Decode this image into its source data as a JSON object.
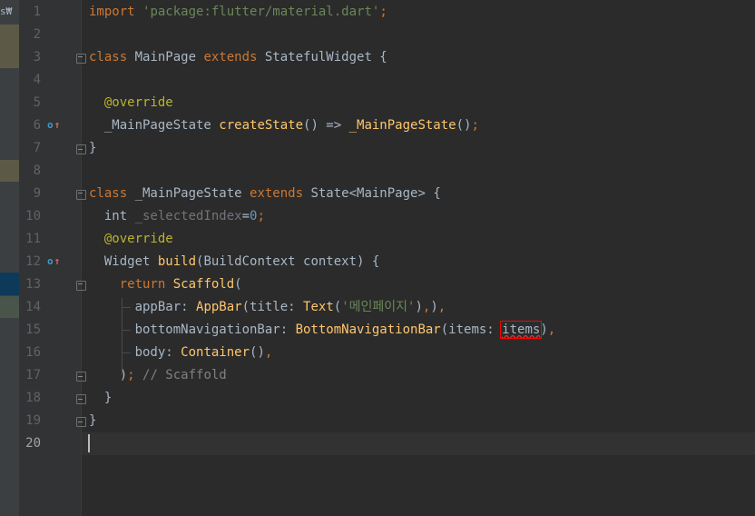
{
  "editor": {
    "left_strip_label": "s₩",
    "caret_line": 20,
    "lines": [
      {
        "num": "1",
        "tokens": [
          {
            "t": "import ",
            "c": "kw"
          },
          {
            "t": "'package:flutter/material.dart'",
            "c": "str"
          },
          {
            "t": ";",
            "c": "kw"
          }
        ]
      },
      {
        "num": "2",
        "tokens": []
      },
      {
        "num": "3",
        "tokens": [
          {
            "t": "class ",
            "c": "kw"
          },
          {
            "t": "MainPage ",
            "c": "cls"
          },
          {
            "t": "extends ",
            "c": "kw"
          },
          {
            "t": "StatefulWidget {",
            "c": "cls"
          }
        ]
      },
      {
        "num": "4",
        "tokens": []
      },
      {
        "num": "5",
        "tokens": [
          {
            "t": "  @override",
            "c": "ann"
          }
        ]
      },
      {
        "num": "6",
        "tokens": [
          {
            "t": "  _MainPageState ",
            "c": "cls"
          },
          {
            "t": "createState",
            "c": "fn"
          },
          {
            "t": "() => ",
            "c": "cls"
          },
          {
            "t": "_MainPageState",
            "c": "fn"
          },
          {
            "t": "()",
            "c": "cls"
          },
          {
            "t": ";",
            "c": "kw"
          }
        ]
      },
      {
        "num": "7",
        "tokens": [
          {
            "t": "}",
            "c": "cls"
          }
        ]
      },
      {
        "num": "8",
        "tokens": []
      },
      {
        "num": "9",
        "tokens": [
          {
            "t": "class ",
            "c": "kw"
          },
          {
            "t": "_MainPageState ",
            "c": "cls"
          },
          {
            "t": "extends ",
            "c": "kw"
          },
          {
            "t": "State<MainPage> {",
            "c": "cls"
          }
        ]
      },
      {
        "num": "10",
        "tokens": [
          {
            "t": "  int ",
            "c": "cls"
          },
          {
            "t": "_selectedIndex",
            "c": "unused"
          },
          {
            "t": "=",
            "c": "cls"
          },
          {
            "t": "0",
            "c": "num"
          },
          {
            "t": ";",
            "c": "kw"
          }
        ]
      },
      {
        "num": "11",
        "tokens": [
          {
            "t": "  @override",
            "c": "ann"
          }
        ]
      },
      {
        "num": "12",
        "tokens": [
          {
            "t": "  Widget ",
            "c": "cls"
          },
          {
            "t": "build",
            "c": "fn"
          },
          {
            "t": "(BuildContext context) {",
            "c": "cls"
          }
        ]
      },
      {
        "num": "13",
        "tokens": [
          {
            "t": "    ",
            "c": "cls"
          },
          {
            "t": "return ",
            "c": "kw"
          },
          {
            "t": "Scaffold",
            "c": "fn"
          },
          {
            "t": "(",
            "c": "cls"
          }
        ]
      },
      {
        "num": "14",
        "tokens": [
          {
            "t": "      appBar: ",
            "c": "named"
          },
          {
            "t": "AppBar",
            "c": "fn"
          },
          {
            "t": "(title: ",
            "c": "cls"
          },
          {
            "t": "Text",
            "c": "fn"
          },
          {
            "t": "(",
            "c": "cls"
          },
          {
            "t": "'메인페이지'",
            "c": "str"
          },
          {
            "t": ")",
            "c": "cls"
          },
          {
            "t": ",",
            "c": "kw"
          },
          {
            "t": ")",
            "c": "cls"
          },
          {
            "t": ",",
            "c": "kw"
          }
        ]
      },
      {
        "num": "15",
        "tokens": [
          {
            "t": "      bottomNavigationBar: ",
            "c": "named"
          },
          {
            "t": "BottomNavigationBar",
            "c": "fn"
          },
          {
            "t": "(items: ",
            "c": "cls"
          },
          {
            "t": "items",
            "c": "err"
          },
          {
            "t": ")",
            "c": "cls"
          },
          {
            "t": ",",
            "c": "kw"
          }
        ]
      },
      {
        "num": "16",
        "tokens": [
          {
            "t": "      body: ",
            "c": "named"
          },
          {
            "t": "Container",
            "c": "fn"
          },
          {
            "t": "()",
            "c": "cls"
          },
          {
            "t": ",",
            "c": "kw"
          }
        ]
      },
      {
        "num": "17",
        "tokens": [
          {
            "t": "    )",
            "c": "cls"
          },
          {
            "t": "; ",
            "c": "kw"
          },
          {
            "t": "// Scaffold",
            "c": "cmt"
          }
        ]
      },
      {
        "num": "18",
        "tokens": [
          {
            "t": "  }",
            "c": "cls"
          }
        ]
      },
      {
        "num": "19",
        "tokens": [
          {
            "t": "}",
            "c": "cls"
          }
        ]
      },
      {
        "num": "20",
        "tokens": []
      }
    ]
  },
  "colors": {
    "background": "#2b2b2b",
    "gutter": "#313335",
    "keyword": "#cc7832",
    "string": "#6a8759",
    "annotation": "#bbb529",
    "function": "#ffc66d",
    "number": "#6897bb",
    "error_box": "#ff0000"
  },
  "gutter_icons": [
    {
      "line": 6,
      "icon": "override-method-icon"
    },
    {
      "line": 12,
      "icon": "override-method-icon"
    }
  ]
}
